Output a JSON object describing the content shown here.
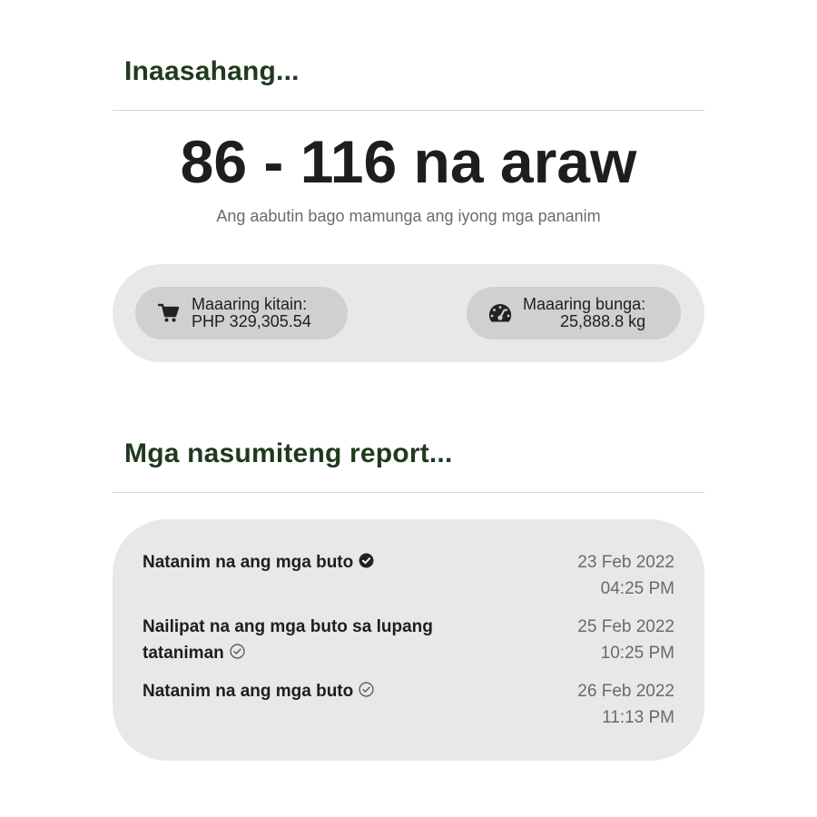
{
  "expected": {
    "title": "Inaasahang...",
    "range": "86 - 116 na araw",
    "subtitle": "Ang aabutin bago mamunga ang iyong mga pananim",
    "income": {
      "icon": "cart-icon",
      "label": "Maaaring kitain:",
      "value": "PHP 329,305.54"
    },
    "yield": {
      "icon": "speedometer-icon",
      "label": "Maaaring bunga:",
      "value": "25,888.8 kg"
    }
  },
  "reports": {
    "title": "Mga nasumiteng report...",
    "items": [
      {
        "text": "Natanim na ang mga buto",
        "status_icon": "check-circle-filled-icon",
        "date": "23 Feb 2022",
        "time": "04:25 PM"
      },
      {
        "text": "Nailipat na ang mga buto sa lupang tataniman",
        "status_icon": "check-circle-outline-icon",
        "date": "25 Feb 2022",
        "time": "10:25 PM"
      },
      {
        "text": "Natanim na ang mga buto",
        "status_icon": "check-circle-outline-icon",
        "date": "26 Feb 2022",
        "time": "11:13 PM"
      }
    ]
  }
}
